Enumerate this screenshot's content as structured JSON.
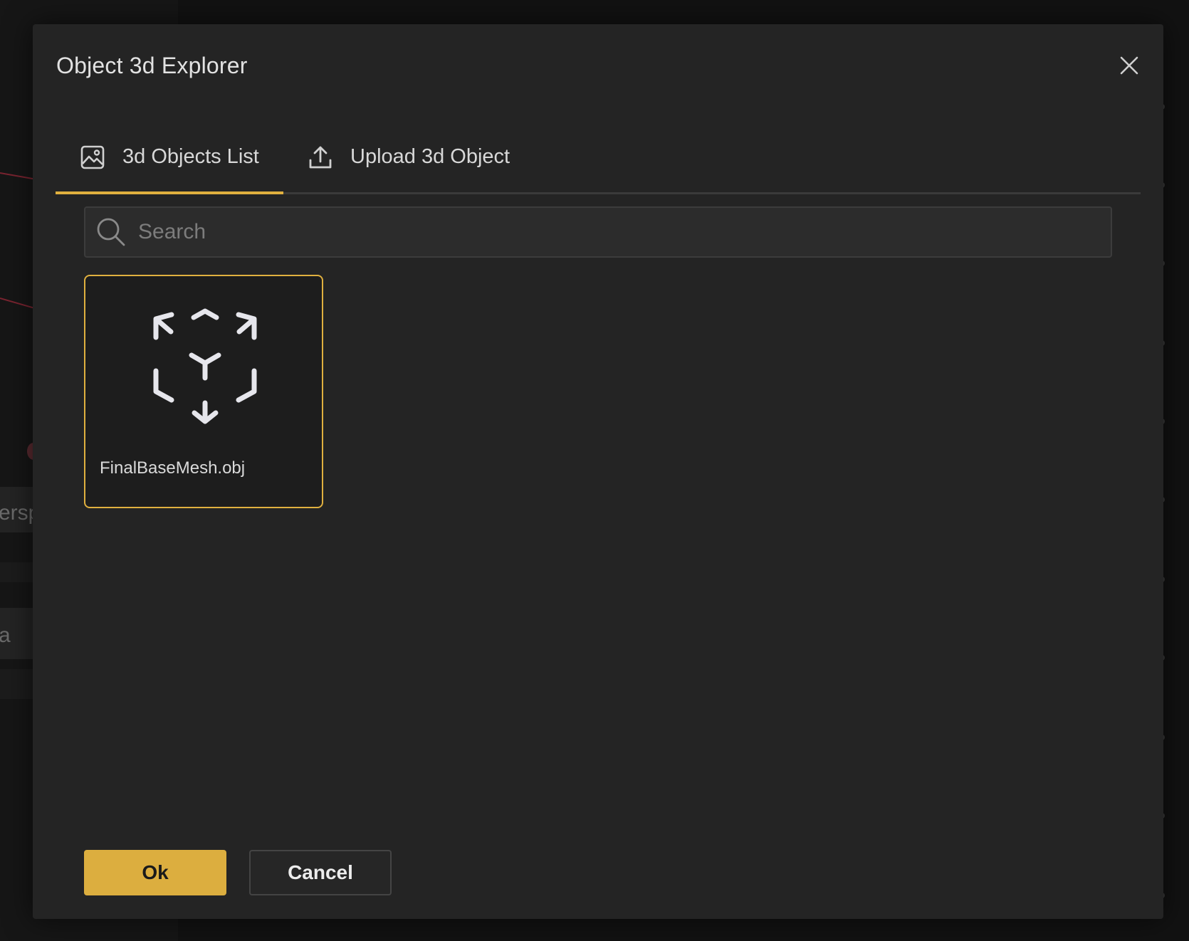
{
  "dialog": {
    "title": "Object 3d Explorer"
  },
  "tabs": [
    {
      "label": "3d Objects List",
      "icon": "image-icon",
      "active": true
    },
    {
      "label": "Upload 3d Object",
      "icon": "upload-icon",
      "active": false
    }
  ],
  "search": {
    "placeholder": "Search",
    "value": ""
  },
  "objects": [
    {
      "name": "FinalBaseMesh.obj",
      "icon": "3d-cube-icon",
      "selected": true
    }
  ],
  "footer": {
    "ok_label": "Ok",
    "cancel_label": "Cancel"
  },
  "background": {
    "partial_text_1": "ersp",
    "partial_text_2": "a"
  },
  "colors": {
    "accent": "#e0b03f",
    "ok_button": "#dcae3f",
    "dialog_bg": "#242424",
    "card_bg": "#1d1d1d",
    "backdrop": "#121212"
  }
}
